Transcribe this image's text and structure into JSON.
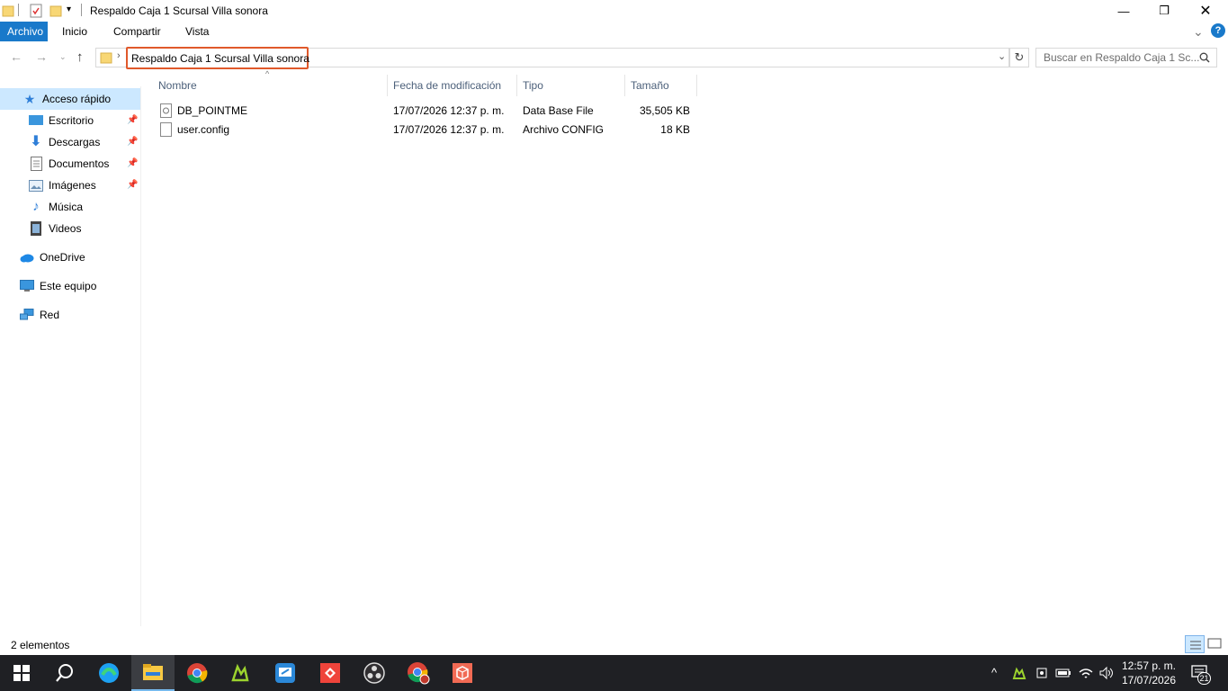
{
  "window": {
    "title": "Respaldo Caja 1 Scursal Villa sonora",
    "minimize_glyph": "—",
    "maximize_glyph": "❐",
    "close_glyph": "✕"
  },
  "ribbon": {
    "tabs": [
      "Archivo",
      "Inicio",
      "Compartir",
      "Vista"
    ],
    "collapse_glyph": "⌄",
    "help_glyph": "?"
  },
  "address": {
    "crumb": "Respaldo Caja 1 Scursal Villa sonora",
    "search_placeholder": "Buscar en Respaldo Caja 1 Sc..."
  },
  "sidebar": {
    "quick_access": "Acceso rápido",
    "items": [
      {
        "label": "Escritorio",
        "icon": "desktop-icon",
        "pinned": true
      },
      {
        "label": "Descargas",
        "icon": "download-icon",
        "pinned": true
      },
      {
        "label": "Documentos",
        "icon": "documents-icon",
        "pinned": true
      },
      {
        "label": "Imágenes",
        "icon": "pictures-icon",
        "pinned": true
      },
      {
        "label": "Música",
        "icon": "music-icon",
        "pinned": false
      },
      {
        "label": "Videos",
        "icon": "videos-icon",
        "pinned": false
      }
    ],
    "onedrive": "OneDrive",
    "this_pc": "Este equipo",
    "network": "Red"
  },
  "columns": [
    "Nombre",
    "Fecha de modificación",
    "Tipo",
    "Tamaño"
  ],
  "files": [
    {
      "name": "DB_POINTME",
      "date": "17/07/2026 12:37 p. m.",
      "type": "Data Base File",
      "size": "35,505 KB",
      "icon": "database-file-icon"
    },
    {
      "name": "user.config",
      "date": "17/07/2026 12:37 p. m.",
      "type": "Archivo CONFIG",
      "size": "18 KB",
      "icon": "config-file-icon"
    }
  ],
  "status": "2 elementos",
  "taskbar": {
    "time": "12:57 p. m.",
    "date": "17/07/2026",
    "notifications": "21",
    "apps": [
      "start",
      "search",
      "edge",
      "file-explorer",
      "chrome",
      "app-green",
      "remote-desktop",
      "anydesk",
      "obs",
      "chrome-profile",
      "app-red-box"
    ]
  },
  "colors": {
    "accent": "#1979ca",
    "highlight_border": "#e0592b",
    "taskbar": "#1f2024",
    "selected": "#cce8ff"
  }
}
